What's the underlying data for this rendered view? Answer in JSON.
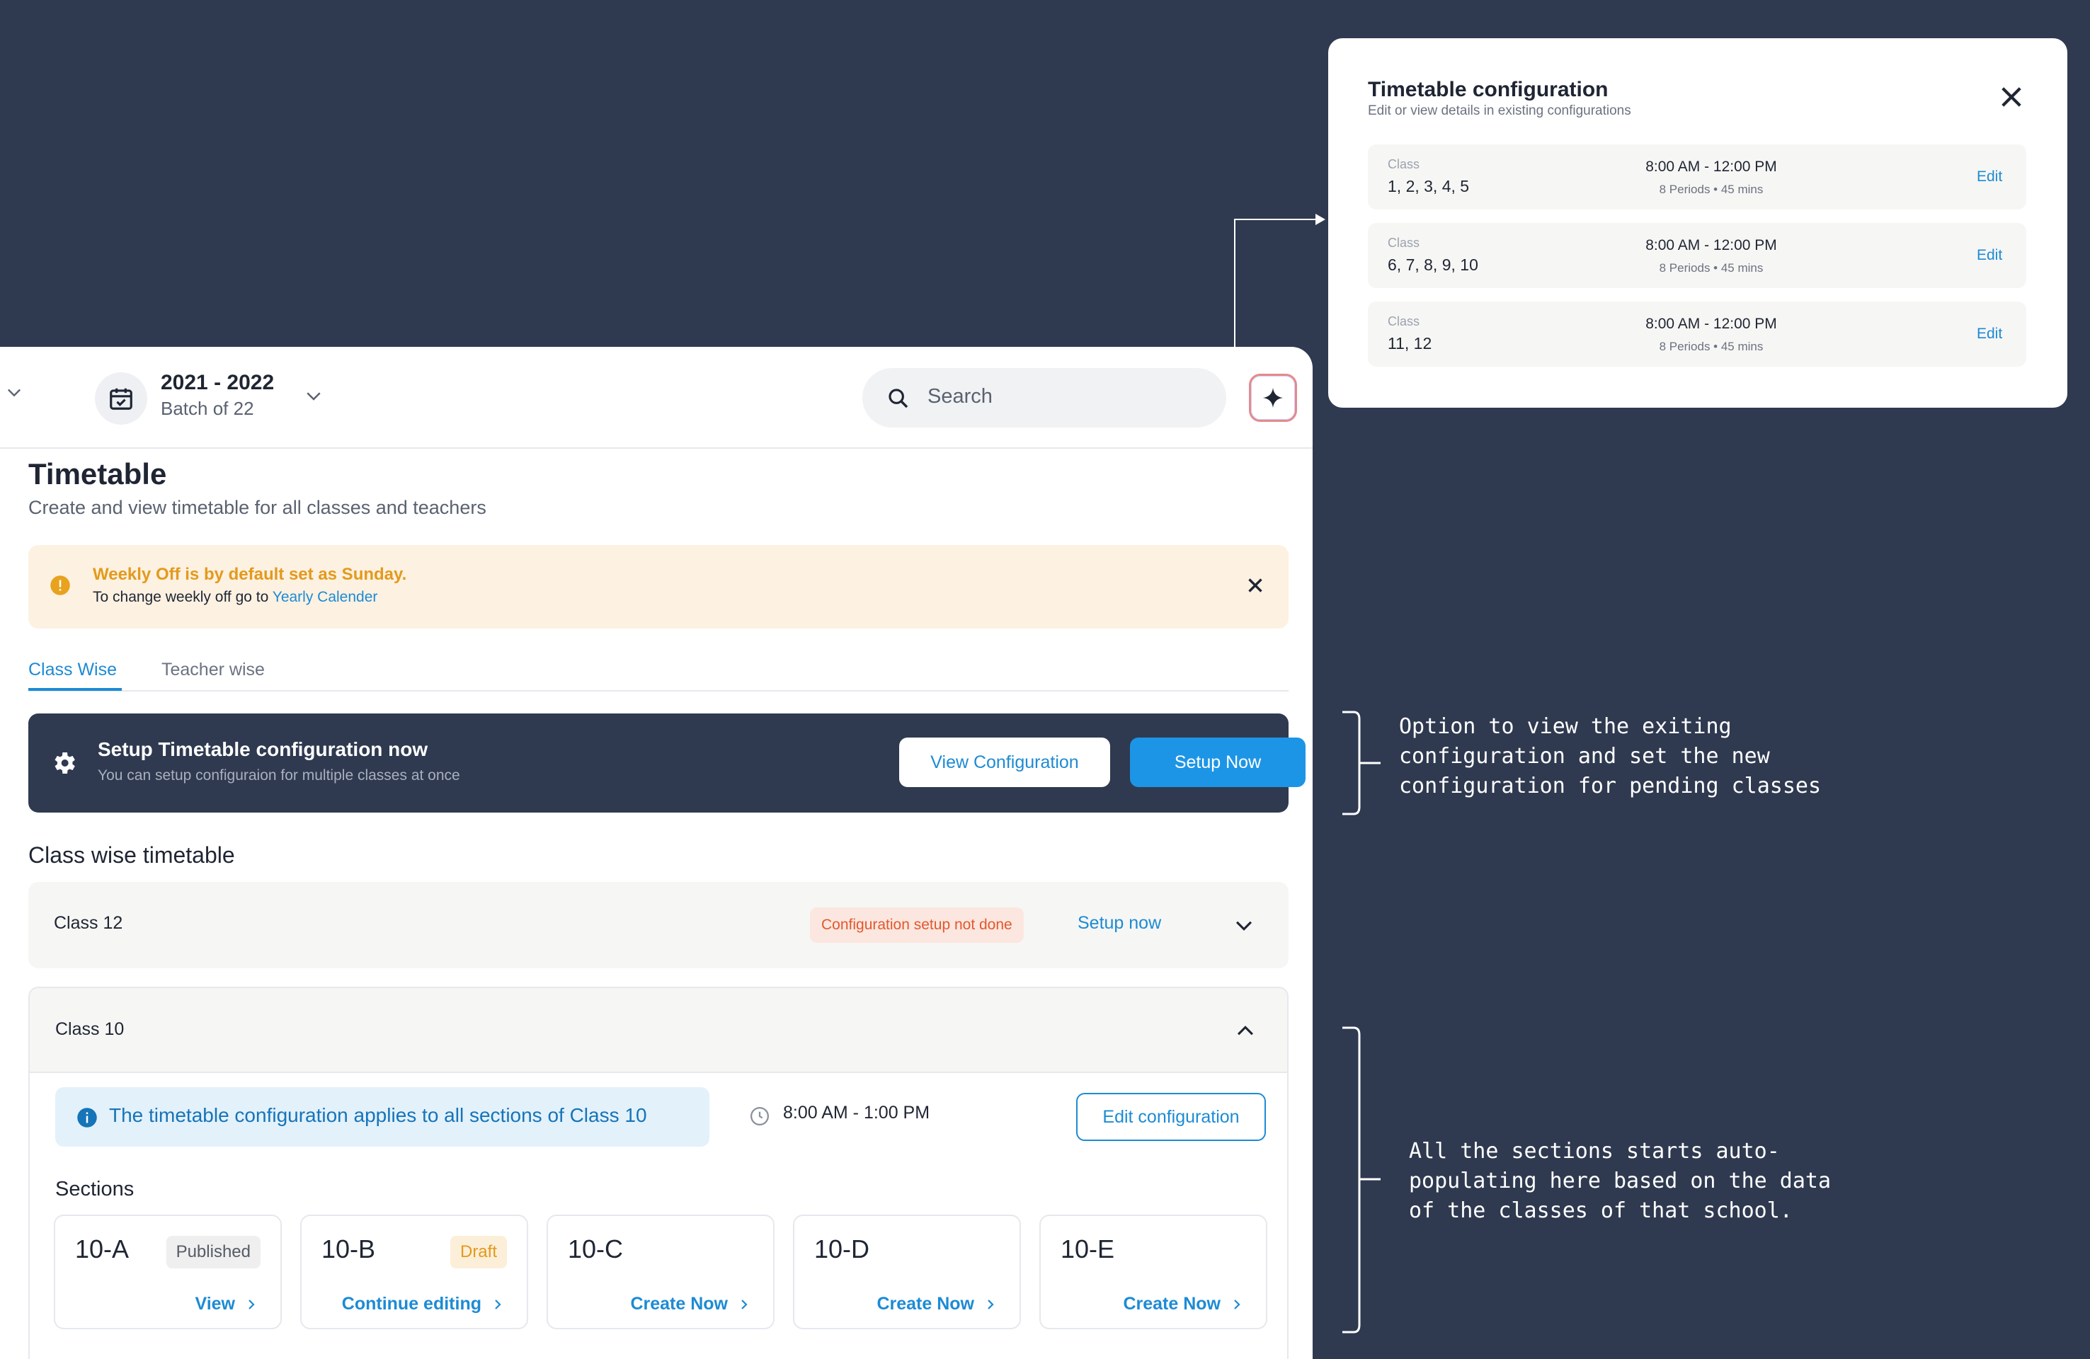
{
  "header": {
    "batch_year": "2021 - 2022",
    "batch_label": "Batch of 22",
    "search_placeholder": "Search"
  },
  "page": {
    "title": "Timetable",
    "subtitle": "Create and view timetable for all classes and teachers"
  },
  "alert": {
    "title": "Weekly Off is by default set as Sunday.",
    "body_prefix": "To change weekly off go to ",
    "link": "Yearly Calender"
  },
  "tabs": [
    {
      "label": "Class Wise",
      "active": true
    },
    {
      "label": "Teacher wise",
      "active": false
    }
  ],
  "banner": {
    "title": "Setup Timetable configuration now",
    "subtitle": "You can setup configuraion for multiple classes at once",
    "view_button": "View Configuration",
    "setup_button": "Setup Now"
  },
  "class_wise": {
    "heading": "Class wise timetable",
    "class12": {
      "name": "Class 12",
      "status": "Configuration setup not done",
      "action": "Setup now"
    },
    "class10": {
      "name": "Class 10",
      "info": "The timetable configuration applies to all sections of Class 10",
      "time": "8:00 AM - 1:00 PM",
      "edit_button": "Edit configuration",
      "sections_label": "Sections",
      "sections": [
        {
          "name": "10-A",
          "badge": "Published",
          "action": "View"
        },
        {
          "name": "10-B",
          "badge": "Draft",
          "action": "Continue editing"
        },
        {
          "name": "10-C",
          "badge": "",
          "action": "Create Now"
        },
        {
          "name": "10-D",
          "badge": "",
          "action": "Create Now"
        },
        {
          "name": "10-E",
          "badge": "",
          "action": "Create Now"
        }
      ]
    }
  },
  "popup": {
    "title": "Timetable configuration",
    "subtitle": "Edit or view details in existing configurations",
    "configs": [
      {
        "label": "Class",
        "classes": "1, 2, 3, 4, 5",
        "time": "8:00 AM - 12:00 PM",
        "periods": "8 Periods • 45 mins",
        "action": "Edit"
      },
      {
        "label": "Class",
        "classes": "6, 7, 8, 9, 10",
        "time": "8:00 AM - 12:00 PM",
        "periods": "8 Periods • 45 mins",
        "action": "Edit"
      },
      {
        "label": "Class",
        "classes": "11, 12",
        "time": "8:00 AM - 12:00 PM",
        "periods": "8 Periods • 45 mins",
        "action": "Edit"
      }
    ]
  },
  "annotations": {
    "note1": "Option to view the exiting\nconfiguration and set the new\nconfiguration for pending classes",
    "note2": "All the sections starts auto-\npopulating here based on the data\nof the classes of that school."
  },
  "colors": {
    "background": "#2f3a50",
    "accent": "#1d8bd4",
    "primary_button": "#1d95e6",
    "warning": "#e39a1c",
    "error": "#e4572e"
  }
}
